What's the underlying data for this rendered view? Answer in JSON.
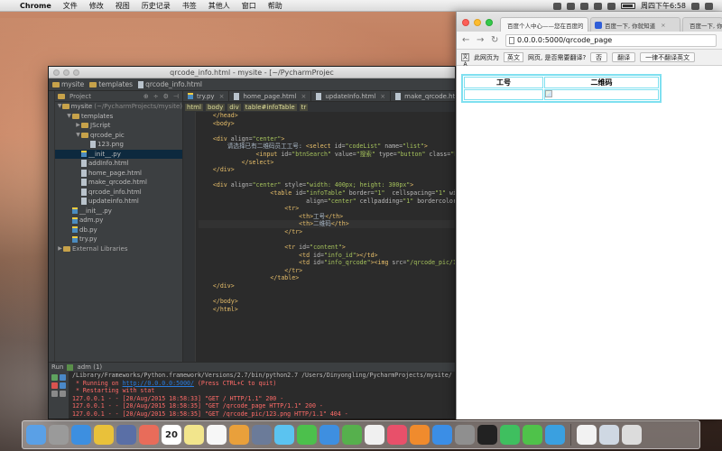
{
  "menubar": {
    "app_name": "Chrome",
    "menus": [
      "文件",
      "修改",
      "视图",
      "历史记录",
      "书签",
      "其他人",
      "窗口",
      "帮助"
    ],
    "clock": "周四下午6:58"
  },
  "ide": {
    "title": "qrcode_info.html - mysite - [~/PycharmProjec",
    "nav": [
      "mysite",
      "templates",
      "qrcode_info.html"
    ],
    "project_label": "Project",
    "tree": [
      {
        "label": "mysite",
        "extra": "(~/PycharmProjects/mysite)",
        "depth": 0,
        "arrow": "▼",
        "icon": "folder"
      },
      {
        "label": "templates",
        "extra": "",
        "depth": 1,
        "arrow": "▼",
        "icon": "folder"
      },
      {
        "label": "JScript",
        "extra": "",
        "depth": 2,
        "arrow": "▶",
        "icon": "folder"
      },
      {
        "label": "qrcode_pic",
        "extra": "",
        "depth": 2,
        "arrow": "▼",
        "icon": "folder"
      },
      {
        "label": "123.png",
        "extra": "",
        "depth": 3,
        "arrow": "",
        "icon": "file"
      },
      {
        "label": "__init__.py",
        "extra": "",
        "depth": 2,
        "arrow": "",
        "icon": "py",
        "selected": true
      },
      {
        "label": "addInfo.html",
        "extra": "",
        "depth": 2,
        "arrow": "",
        "icon": "file"
      },
      {
        "label": "home_page.html",
        "extra": "",
        "depth": 2,
        "arrow": "",
        "icon": "file"
      },
      {
        "label": "make_qrcode.html",
        "extra": "",
        "depth": 2,
        "arrow": "",
        "icon": "file"
      },
      {
        "label": "qrcode_info.html",
        "extra": "",
        "depth": 2,
        "arrow": "",
        "icon": "file"
      },
      {
        "label": "updateinfo.html",
        "extra": "",
        "depth": 2,
        "arrow": "",
        "icon": "file"
      },
      {
        "label": "__init__.py",
        "extra": "",
        "depth": 1,
        "arrow": "",
        "icon": "py"
      },
      {
        "label": "adm.py",
        "extra": "",
        "depth": 1,
        "arrow": "",
        "icon": "py"
      },
      {
        "label": "db.py",
        "extra": "",
        "depth": 1,
        "arrow": "",
        "icon": "py"
      },
      {
        "label": "try.py",
        "extra": "",
        "depth": 1,
        "arrow": "",
        "icon": "py"
      },
      {
        "label": "External Libraries",
        "extra": "",
        "depth": 0,
        "arrow": "▶",
        "icon": "lib"
      }
    ],
    "tabs": [
      {
        "label": "try.py",
        "active": false,
        "icon": "py"
      },
      {
        "label": "home_page.html",
        "active": false,
        "icon": "file"
      },
      {
        "label": "updateInfo.html",
        "active": false,
        "icon": "file"
      },
      {
        "label": "make_qrcode.html",
        "active": false,
        "icon": "file"
      },
      {
        "label": "qrcode_info.html",
        "active": true,
        "icon": "file"
      }
    ],
    "breadcrumbs": [
      "html",
      "body",
      "div",
      "table#infoTable",
      "tr"
    ],
    "code_lines": [
      {
        "indent": 4,
        "tokens": [
          [
            "tg",
            "</head>"
          ]
        ]
      },
      {
        "indent": 4,
        "tokens": [
          [
            "tg",
            "<body>"
          ]
        ]
      },
      {
        "indent": 0,
        "tokens": []
      },
      {
        "indent": 4,
        "tokens": [
          [
            "tg",
            "<div "
          ],
          [
            "at",
            "align="
          ],
          [
            "sv",
            "\"center\""
          ],
          [
            "tg",
            ">"
          ]
        ]
      },
      {
        "indent": 8,
        "tokens": [
          [
            "tx",
            "请选择已有二维码员工工号: "
          ],
          [
            "tg",
            "<select "
          ],
          [
            "at",
            "id="
          ],
          [
            "sv",
            "\"codeList\" "
          ],
          [
            "at",
            "name="
          ],
          [
            "sv",
            "\"list\""
          ],
          [
            "tg",
            ">"
          ]
        ]
      },
      {
        "indent": 16,
        "tokens": [
          [
            "tg",
            "<input "
          ],
          [
            "at",
            "id="
          ],
          [
            "sv",
            "\"btnSearch\" "
          ],
          [
            "at",
            "value="
          ],
          [
            "sv",
            "\"搜索\" "
          ],
          [
            "at",
            "type="
          ],
          [
            "sv",
            "\"button\" "
          ],
          [
            "at",
            "class="
          ],
          [
            "sv",
            "\"btn\""
          ],
          [
            "tg",
            "/>"
          ]
        ]
      },
      {
        "indent": 12,
        "tokens": [
          [
            "tg",
            "</select>"
          ]
        ]
      },
      {
        "indent": 4,
        "tokens": [
          [
            "tg",
            "</div>"
          ]
        ]
      },
      {
        "indent": 0,
        "tokens": []
      },
      {
        "indent": 4,
        "tokens": [
          [
            "tg",
            "<div "
          ],
          [
            "at",
            "align="
          ],
          [
            "sv",
            "\"center\" "
          ],
          [
            "at",
            "style="
          ],
          [
            "sv",
            "\"width: 400px; height: 300px\""
          ],
          [
            "tg",
            ">"
          ]
        ]
      },
      {
        "indent": 20,
        "tokens": [
          [
            "tg",
            "<table "
          ],
          [
            "at",
            "id="
          ],
          [
            "sv",
            "\"infoTable\" "
          ],
          [
            "at",
            "border="
          ],
          [
            "sv",
            "\"1\"  "
          ],
          [
            "at",
            "cellspacing="
          ],
          [
            "sv",
            "\"1\" "
          ],
          [
            "at",
            "widt"
          ]
        ]
      },
      {
        "indent": 30,
        "tokens": [
          [
            "at",
            "align="
          ],
          [
            "sv",
            "\"center\" "
          ],
          [
            "at",
            "cellpadding="
          ],
          [
            "sv",
            "\"1\" "
          ],
          [
            "at",
            "bordercolor="
          ],
          [
            "sv",
            "\"#00"
          ]
        ]
      },
      {
        "indent": 24,
        "tokens": [
          [
            "tg",
            "<tr>"
          ]
        ]
      },
      {
        "indent": 28,
        "tokens": [
          [
            "tg",
            "<th>"
          ],
          [
            "tx",
            "工号"
          ],
          [
            "tg",
            "</th>"
          ]
        ]
      },
      {
        "indent": 28,
        "tokens": [
          [
            "tg",
            "<th>"
          ],
          [
            "tx",
            "二维码"
          ],
          [
            "tg",
            "</th>"
          ]
        ],
        "current": true
      },
      {
        "indent": 24,
        "tokens": [
          [
            "tg",
            "</tr>"
          ]
        ]
      },
      {
        "indent": 0,
        "tokens": []
      },
      {
        "indent": 24,
        "tokens": [
          [
            "tg",
            "<tr "
          ],
          [
            "at",
            "id="
          ],
          [
            "sv",
            "\"content\""
          ],
          [
            "tg",
            ">"
          ]
        ]
      },
      {
        "indent": 28,
        "tokens": [
          [
            "tg",
            "<td "
          ],
          [
            "at",
            "id="
          ],
          [
            "sv",
            "\"info_id\""
          ],
          [
            "tg",
            "></td>"
          ]
        ]
      },
      {
        "indent": 28,
        "tokens": [
          [
            "tg",
            "<td "
          ],
          [
            "at",
            "id="
          ],
          [
            "sv",
            "\"info_qrcode\""
          ],
          [
            "tg",
            "><img "
          ],
          [
            "at",
            "src="
          ],
          [
            "sv",
            "\"/qrcode_pic/12"
          ]
        ]
      },
      {
        "indent": 24,
        "tokens": [
          [
            "tg",
            "</tr>"
          ]
        ]
      },
      {
        "indent": 20,
        "tokens": [
          [
            "tg",
            "</table>"
          ]
        ]
      },
      {
        "indent": 4,
        "tokens": [
          [
            "tg",
            "</div>"
          ]
        ]
      },
      {
        "indent": 0,
        "tokens": []
      },
      {
        "indent": 4,
        "tokens": [
          [
            "tg",
            "</body>"
          ]
        ]
      },
      {
        "indent": 4,
        "tokens": [
          [
            "tg",
            "</html>"
          ]
        ]
      }
    ],
    "run": {
      "label": "Run",
      "config": "adm (1)",
      "console": [
        {
          "cls": "c-path",
          "text": "/Library/Frameworks/Python.framework/Versions/2.7/bin/python2.7 /Users/Dinyongling/PycharmProjects/mysite/"
        },
        {
          "cls": "c-red",
          "prefix": " * Running on ",
          "link": "http://0.0.0.0:5000/",
          "suffix": " (Press CTRL+C to quit)"
        },
        {
          "cls": "c-red",
          "text": " * Restarting with stat"
        },
        {
          "cls": "c-red",
          "text": "127.0.0.1 - - [20/Aug/2015 18:58:33] \"GET / HTTP/1.1\" 200 -"
        },
        {
          "cls": "c-red",
          "text": "127.0.0.1 - - [20/Aug/2015 18:58:35] \"GET /qrcode_page HTTP/1.1\" 200 -"
        },
        {
          "cls": "c-red",
          "text": "127.0.0.1 - - [20/Aug/2015 18:58:35] \"GET /qrcode_pic/123.png HTTP/1.1\" 404 -"
        }
      ]
    }
  },
  "browser": {
    "tabs": [
      {
        "label": "百度个人中心——您在百度的"
      },
      {
        "label": "百度一下, 你就知道"
      },
      {
        "label": "百度一下, 你就知道"
      }
    ],
    "url_host": "0.0.0.0",
    "url_rest": ":5000/qrcode_page",
    "translate": {
      "page_is": "此网页为",
      "language": "英文",
      "question": "网页, 是否需要翻译?",
      "no": "否",
      "translate": "翻译",
      "never": "一律不翻译英文"
    },
    "table": {
      "headers": [
        "工号",
        "二维码"
      ]
    }
  },
  "dock": {
    "calendar_day": "20",
    "icons": [
      {
        "name": "finder-icon",
        "color": "#5aa0e6"
      },
      {
        "name": "launchpad-icon",
        "color": "#9a9a9a"
      },
      {
        "name": "safari-icon",
        "color": "#3d8fe0"
      },
      {
        "name": "chrome-icon",
        "color": "#e9c13a"
      },
      {
        "name": "preview-icon",
        "color": "#5a6fa6"
      },
      {
        "name": "photos-icon",
        "color": "#e86c5a"
      },
      {
        "name": "calendar-icon",
        "color": "#ffffff"
      },
      {
        "name": "notes-icon",
        "color": "#f2e58c"
      },
      {
        "name": "reminders-icon",
        "color": "#f7f7f7"
      },
      {
        "name": "pages-icon",
        "color": "#e9a03b"
      },
      {
        "name": "mission-control-icon",
        "color": "#6b7b99"
      },
      {
        "name": "messages-icon",
        "color": "#5bc3f0"
      },
      {
        "name": "facetime-icon",
        "color": "#4cc04c"
      },
      {
        "name": "keynote-icon",
        "color": "#3e8fe0"
      },
      {
        "name": "numbers-icon",
        "color": "#56b04d"
      },
      {
        "name": "text-edit-icon",
        "color": "#f0f0f0"
      },
      {
        "name": "itunes-icon",
        "color": "#e8506a"
      },
      {
        "name": "ibooks-icon",
        "color": "#f08b2d"
      },
      {
        "name": "app-store-icon",
        "color": "#3b8ee6"
      },
      {
        "name": "system-preferences-icon",
        "color": "#8f8f8f"
      },
      {
        "name": "terminal-icon",
        "color": "#222222"
      },
      {
        "name": "pycharm-icon",
        "color": "#3fbf5f"
      },
      {
        "name": "wechat-icon",
        "color": "#4fc24a"
      },
      {
        "name": "qq-icon",
        "color": "#3aa0e0"
      },
      {
        "name": "document-icon",
        "color": "#f2f2f2"
      },
      {
        "name": "downloads-icon",
        "color": "#cfd8e3"
      },
      {
        "name": "trash-icon",
        "color": "#dcdcdc"
      }
    ]
  }
}
